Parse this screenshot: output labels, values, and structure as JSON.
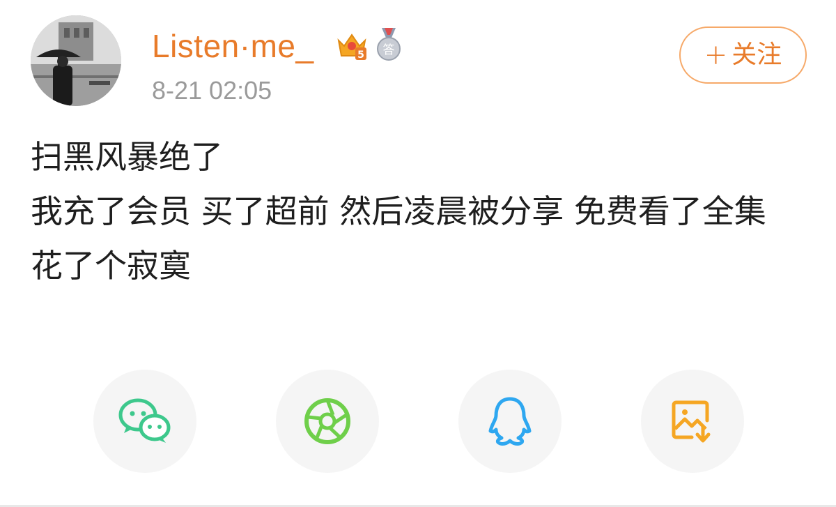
{
  "post": {
    "author": {
      "name": "Listen·me_",
      "name_color": "#e87b2a",
      "badges": [
        {
          "icon": "vip-crown-icon",
          "text": "5"
        },
        {
          "icon": "answer-medal-icon",
          "text": "答"
        }
      ]
    },
    "timestamp": "8-21 02:05",
    "follow_button": {
      "plus": "+",
      "label": "关注",
      "color": "#e87b2a"
    },
    "lines": [
      "扫黑风暴绝了",
      "我充了会员  买了超前  然后凌晨被分享  免费看了全集",
      "花了个寂寞"
    ]
  },
  "share_bar": {
    "items": [
      {
        "icon": "wechat-icon",
        "color": "#3dc88c"
      },
      {
        "icon": "moments-shutter-icon",
        "color": "#6fcf4a"
      },
      {
        "icon": "qq-penguin-icon",
        "color": "#2ea7f0"
      },
      {
        "icon": "save-image-icon",
        "color": "#f5a623"
      }
    ]
  }
}
